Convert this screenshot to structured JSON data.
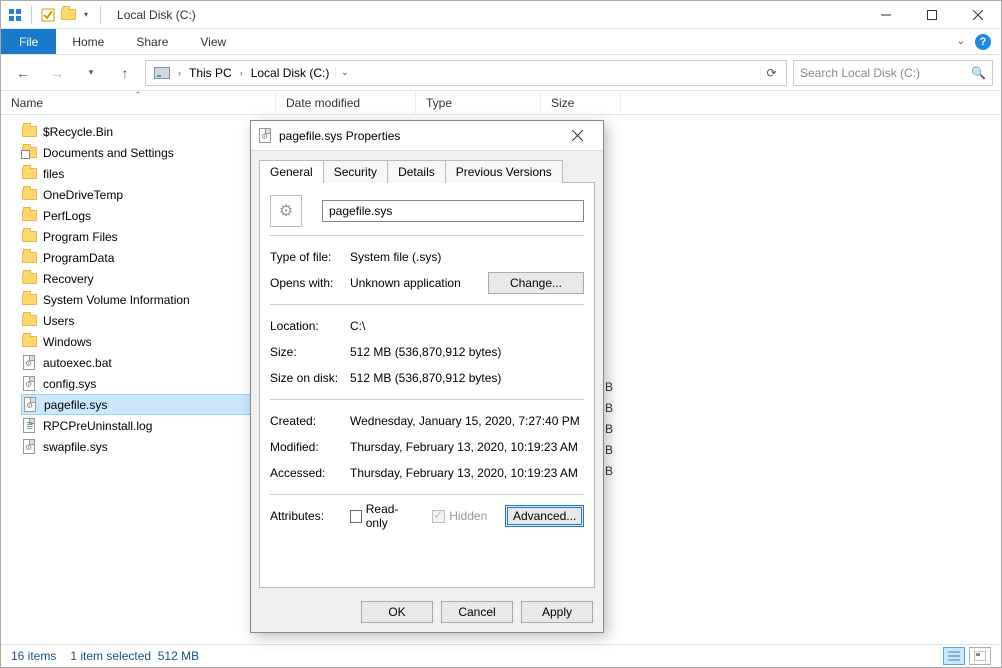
{
  "window": {
    "title": "Local Disk (C:)",
    "quick_access_checked": true
  },
  "ribbon": {
    "file": "File",
    "tabs": [
      "Home",
      "Share",
      "View"
    ]
  },
  "breadcrumb": {
    "items": [
      "This PC",
      "Local Disk (C:)"
    ]
  },
  "search": {
    "placeholder": "Search Local Disk (C:)"
  },
  "columns": {
    "name": "Name",
    "date": "Date modified",
    "type": "Type",
    "size": "Size"
  },
  "files": [
    {
      "name": "$Recycle.Bin",
      "icon": "folder"
    },
    {
      "name": "Documents and Settings",
      "icon": "folder-shortcut"
    },
    {
      "name": "files",
      "icon": "folder"
    },
    {
      "name": "OneDriveTemp",
      "icon": "folder"
    },
    {
      "name": "PerfLogs",
      "icon": "folder"
    },
    {
      "name": "Program Files",
      "icon": "folder"
    },
    {
      "name": "ProgramData",
      "icon": "folder"
    },
    {
      "name": "Recovery",
      "icon": "folder"
    },
    {
      "name": "System Volume Information",
      "icon": "folder"
    },
    {
      "name": "Users",
      "icon": "folder"
    },
    {
      "name": "Windows",
      "icon": "folder"
    },
    {
      "name": "autoexec.bat",
      "icon": "file-gear"
    },
    {
      "name": "config.sys",
      "icon": "file-gear"
    },
    {
      "name": "pagefile.sys",
      "icon": "file-gear",
      "selected": true
    },
    {
      "name": "RPCPreUninstall.log",
      "icon": "file-log"
    },
    {
      "name": "swapfile.sys",
      "icon": "file-gear"
    }
  ],
  "size_letters": [
    "B",
    "B",
    "B",
    "B",
    "B"
  ],
  "statusbar": {
    "count": "16 items",
    "selection": "1 item selected",
    "sel_size": "512 MB"
  },
  "dialog": {
    "title": "pagefile.sys Properties",
    "tabs": [
      "General",
      "Security",
      "Details",
      "Previous Versions"
    ],
    "filename": "pagefile.sys",
    "rows": {
      "type_label": "Type of file:",
      "type_value": "System file (.sys)",
      "opens_label": "Opens with:",
      "opens_value": "Unknown application",
      "change_btn": "Change...",
      "location_label": "Location:",
      "location_value": "C:\\",
      "size_label": "Size:",
      "size_value": "512 MB (536,870,912 bytes)",
      "disk_label": "Size on disk:",
      "disk_value": "512 MB (536,870,912 bytes)",
      "created_label": "Created:",
      "created_value": "Wednesday, January 15, 2020, 7:27:40 PM",
      "modified_label": "Modified:",
      "modified_value": "Thursday, February 13, 2020, 10:19:23 AM",
      "accessed_label": "Accessed:",
      "accessed_value": "Thursday, February 13, 2020, 10:19:23 AM",
      "attr_label": "Attributes:",
      "readonly": "Read-only",
      "hidden": "Hidden",
      "advanced": "Advanced..."
    },
    "footer": {
      "ok": "OK",
      "cancel": "Cancel",
      "apply": "Apply"
    }
  }
}
